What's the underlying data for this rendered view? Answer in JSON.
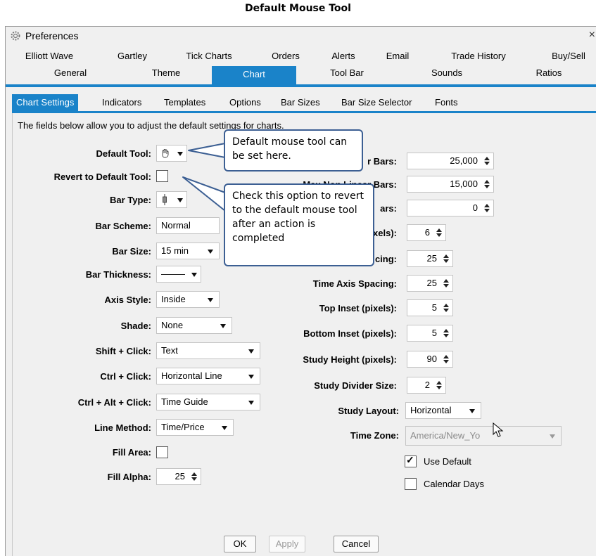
{
  "page_title": "Default Mouse Tool",
  "window": {
    "title": "Preferences",
    "close_glyph": "×"
  },
  "top_tabs_row1": [
    "Elliott Wave",
    "Gartley",
    "Tick Charts",
    "Orders",
    "Alerts",
    "Email",
    "Trade History",
    "Buy/Sell"
  ],
  "top_tabs_row2": [
    "General",
    "Theme",
    "Chart",
    "Tool Bar",
    "Sounds",
    "Ratios"
  ],
  "top_tabs_selected": "Chart",
  "sub_tabs": [
    "Chart Settings",
    "Indicators",
    "Templates",
    "Options",
    "Bar Sizes",
    "Bar Size Selector",
    "Fonts"
  ],
  "sub_tabs_selected": "Chart Settings",
  "intro": "The fields below allow you to adjust the default settings for charts.",
  "left": {
    "default_tool_label": "Default Tool:",
    "revert_label": "Revert to Default Tool:",
    "revert_checked": false,
    "bar_type_label": "Bar Type:",
    "bar_scheme_label": "Bar Scheme:",
    "bar_scheme_value": "Normal",
    "bar_size_label": "Bar Size:",
    "bar_size_value": "15 min",
    "bar_thickness_label": "Bar Thickness:",
    "axis_style_label": "Axis Style:",
    "axis_style_value": "Inside",
    "shade_label": "Shade:",
    "shade_value": "None",
    "shift_click_label": "Shift + Click:",
    "shift_click_value": "Text",
    "ctrl_click_label": "Ctrl + Click:",
    "ctrl_click_value": "Horizontal Line",
    "ctrl_alt_click_label": "Ctrl + Alt + Click:",
    "ctrl_alt_click_value": "Time Guide",
    "line_method_label": "Line Method:",
    "line_method_value": "Time/Price",
    "fill_area_label": "Fill Area:",
    "fill_area_checked": false,
    "fill_alpha_label": "Fill Alpha:",
    "fill_alpha_value": "25"
  },
  "right": {
    "linear_bars_label": "r Bars:",
    "linear_bars_value": "25,000",
    "max_nonlinear_label": "Max Non Linear Bars:",
    "max_nonlinear_value": "15,000",
    "bars3_label": "ars:",
    "bars3_value": "0",
    "pixels_label": "xels):",
    "pixels_value": "6",
    "spacing_label": "cing:",
    "spacing_value": "25",
    "time_axis_label": "Time Axis Spacing:",
    "time_axis_value": "25",
    "top_inset_label": "Top Inset (pixels):",
    "top_inset_value": "5",
    "bottom_inset_label": "Bottom Inset (pixels):",
    "bottom_inset_value": "5",
    "study_height_label": "Study Height (pixels):",
    "study_height_value": "90",
    "study_divider_label": "Study Divider Size:",
    "study_divider_value": "2",
    "study_layout_label": "Study Layout:",
    "study_layout_value": "Horizontal",
    "time_zone_label": "Time Zone:",
    "time_zone_value": "America/New_Yo",
    "use_default_label": "Use Default",
    "use_default_checked": true,
    "calendar_days_label": "Calendar Days",
    "calendar_days_checked": false
  },
  "callouts": {
    "tool": "Default mouse tool can be set here.",
    "revert": "Check this option to revert to the default mouse tool after an action is completed"
  },
  "buttons": {
    "ok": "OK",
    "apply": "Apply",
    "cancel": "Cancel"
  },
  "colors": {
    "accent": "#1a83c9",
    "callout_border": "#3c5f93",
    "window_bg": "#f0f0f0"
  }
}
